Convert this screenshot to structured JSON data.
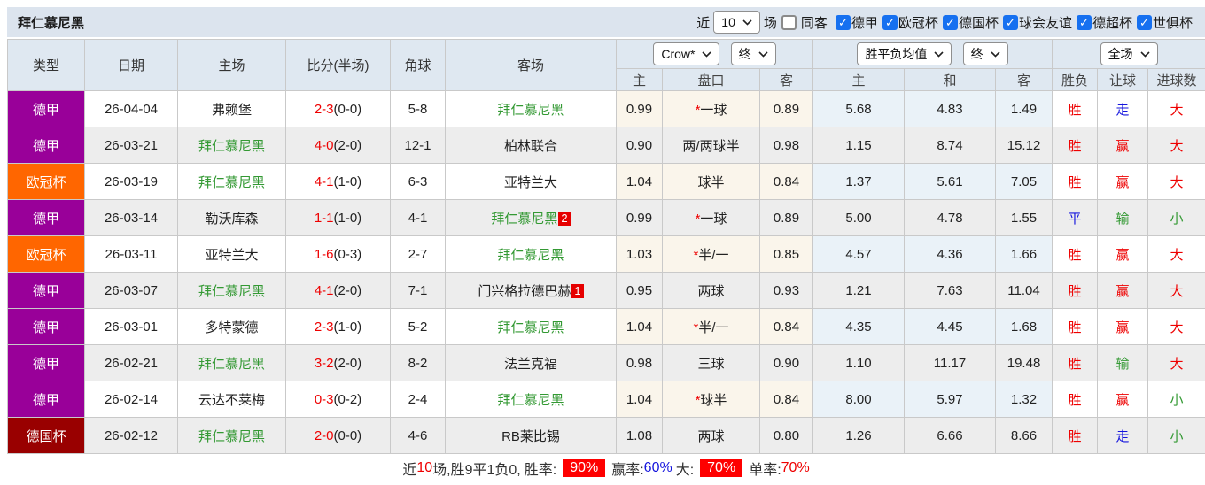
{
  "title": "拜仁慕尼黑",
  "controls": {
    "recent_label": "近",
    "recent_value": "10",
    "games_label": "场",
    "same_venue_label": "同客",
    "same_venue_checked": false,
    "competitions": [
      {
        "label": "德甲",
        "checked": true
      },
      {
        "label": "欧冠杯",
        "checked": true
      },
      {
        "label": "德国杯",
        "checked": true
      },
      {
        "label": "球会友谊",
        "checked": true
      },
      {
        "label": "德超杯",
        "checked": true
      },
      {
        "label": "世俱杯",
        "checked": true
      }
    ]
  },
  "table": {
    "columns_left": [
      "类型",
      "日期",
      "主场",
      "比分(半场)",
      "角球",
      "客场"
    ],
    "selects": {
      "odds_company": "Crow*",
      "odds_time": "终",
      "avg_name": "胜平负均值",
      "avg_time": "终",
      "scope": "全场"
    },
    "sub": [
      "主",
      "盘口",
      "客",
      "主",
      "和",
      "客",
      "胜负",
      "让球",
      "进球数"
    ]
  },
  "colors": {
    "league_dejia": "#990099",
    "league_ouguan": "#ff6600",
    "league_deguobei": "#990000",
    "win_red": "#ee0000",
    "draw_blue": "#1515dd",
    "lose_green": "#339933",
    "accent_badge": "#fe0000"
  },
  "matches": [
    {
      "type": "德甲",
      "type_color": "#990099",
      "date": "26-04-04",
      "home": "弗赖堡",
      "home_green": false,
      "score": "2-3",
      "half": "(0-0)",
      "corner": "5-8",
      "away": "拜仁慕尼黑",
      "away_green": true,
      "away_badge": "",
      "odds_home": "0.99",
      "handicap": "一球",
      "handicap_star": true,
      "odds_away": "0.89",
      "avg_home": "5.68",
      "avg_draw": "4.83",
      "avg_away": "1.49",
      "result": "胜",
      "result_color": "#ee0000",
      "handicap_result": "走",
      "handicap_result_color": "#1515dd",
      "goals": "大",
      "goals_color": "#ee0000"
    },
    {
      "type": "德甲",
      "type_color": "#990099",
      "date": "26-03-21",
      "home": "拜仁慕尼黑",
      "home_green": true,
      "score": "4-0",
      "half": "(2-0)",
      "corner": "12-1",
      "away": "柏林联合",
      "away_green": false,
      "away_badge": "",
      "odds_home": "0.90",
      "handicap": "两/两球半",
      "handicap_star": false,
      "odds_away": "0.98",
      "avg_home": "1.15",
      "avg_draw": "8.74",
      "avg_away": "15.12",
      "result": "胜",
      "result_color": "#ee0000",
      "handicap_result": "赢",
      "handicap_result_color": "#ee0000",
      "goals": "大",
      "goals_color": "#ee0000"
    },
    {
      "type": "欧冠杯",
      "type_color": "#ff6600",
      "date": "26-03-19",
      "home": "拜仁慕尼黑",
      "home_green": true,
      "score": "4-1",
      "half": "(1-0)",
      "corner": "6-3",
      "away": "亚特兰大",
      "away_green": false,
      "away_badge": "",
      "odds_home": "1.04",
      "handicap": "球半",
      "handicap_star": false,
      "odds_away": "0.84",
      "avg_home": "1.37",
      "avg_draw": "5.61",
      "avg_away": "7.05",
      "result": "胜",
      "result_color": "#ee0000",
      "handicap_result": "赢",
      "handicap_result_color": "#ee0000",
      "goals": "大",
      "goals_color": "#ee0000"
    },
    {
      "type": "德甲",
      "type_color": "#990099",
      "date": "26-03-14",
      "home": "勒沃库森",
      "home_green": false,
      "score": "1-1",
      "half": "(1-0)",
      "corner": "4-1",
      "away": "拜仁慕尼黑",
      "away_green": true,
      "away_badge": "2",
      "odds_home": "0.99",
      "handicap": "一球",
      "handicap_star": true,
      "odds_away": "0.89",
      "avg_home": "5.00",
      "avg_draw": "4.78",
      "avg_away": "1.55",
      "result": "平",
      "result_color": "#1515dd",
      "handicap_result": "输",
      "handicap_result_color": "#339933",
      "goals": "小",
      "goals_color": "#339933"
    },
    {
      "type": "欧冠杯",
      "type_color": "#ff6600",
      "date": "26-03-11",
      "home": "亚特兰大",
      "home_green": false,
      "score": "1-6",
      "half": "(0-3)",
      "corner": "2-7",
      "away": "拜仁慕尼黑",
      "away_green": true,
      "away_badge": "",
      "odds_home": "1.03",
      "handicap": "半/一",
      "handicap_star": true,
      "odds_away": "0.85",
      "avg_home": "4.57",
      "avg_draw": "4.36",
      "avg_away": "1.66",
      "result": "胜",
      "result_color": "#ee0000",
      "handicap_result": "赢",
      "handicap_result_color": "#ee0000",
      "goals": "大",
      "goals_color": "#ee0000"
    },
    {
      "type": "德甲",
      "type_color": "#990099",
      "date": "26-03-07",
      "home": "拜仁慕尼黑",
      "home_green": true,
      "score": "4-1",
      "half": "(2-0)",
      "corner": "7-1",
      "away": "门兴格拉德巴赫",
      "away_green": false,
      "away_badge": "1",
      "odds_home": "0.95",
      "handicap": "两球",
      "handicap_star": false,
      "odds_away": "0.93",
      "avg_home": "1.21",
      "avg_draw": "7.63",
      "avg_away": "11.04",
      "result": "胜",
      "result_color": "#ee0000",
      "handicap_result": "赢",
      "handicap_result_color": "#ee0000",
      "goals": "大",
      "goals_color": "#ee0000"
    },
    {
      "type": "德甲",
      "type_color": "#990099",
      "date": "26-03-01",
      "home": "多特蒙德",
      "home_green": false,
      "score": "2-3",
      "half": "(1-0)",
      "corner": "5-2",
      "away": "拜仁慕尼黑",
      "away_green": true,
      "away_badge": "",
      "odds_home": "1.04",
      "handicap": "半/一",
      "handicap_star": true,
      "odds_away": "0.84",
      "avg_home": "4.35",
      "avg_draw": "4.45",
      "avg_away": "1.68",
      "result": "胜",
      "result_color": "#ee0000",
      "handicap_result": "赢",
      "handicap_result_color": "#ee0000",
      "goals": "大",
      "goals_color": "#ee0000"
    },
    {
      "type": "德甲",
      "type_color": "#990099",
      "date": "26-02-21",
      "home": "拜仁慕尼黑",
      "home_green": true,
      "score": "3-2",
      "half": "(2-0)",
      "corner": "8-2",
      "away": "法兰克福",
      "away_green": false,
      "away_badge": "",
      "odds_home": "0.98",
      "handicap": "三球",
      "handicap_star": false,
      "odds_away": "0.90",
      "avg_home": "1.10",
      "avg_draw": "11.17",
      "avg_away": "19.48",
      "result": "胜",
      "result_color": "#ee0000",
      "handicap_result": "输",
      "handicap_result_color": "#339933",
      "goals": "大",
      "goals_color": "#ee0000"
    },
    {
      "type": "德甲",
      "type_color": "#990099",
      "date": "26-02-14",
      "home": "云达不莱梅",
      "home_green": false,
      "score": "0-3",
      "half": "(0-2)",
      "corner": "2-4",
      "away": "拜仁慕尼黑",
      "away_green": true,
      "away_badge": "",
      "odds_home": "1.04",
      "handicap": "球半",
      "handicap_star": true,
      "odds_away": "0.84",
      "avg_home": "8.00",
      "avg_draw": "5.97",
      "avg_away": "1.32",
      "result": "胜",
      "result_color": "#ee0000",
      "handicap_result": "赢",
      "handicap_result_color": "#ee0000",
      "goals": "小",
      "goals_color": "#339933"
    },
    {
      "type": "德国杯",
      "type_color": "#990000",
      "date": "26-02-12",
      "home": "拜仁慕尼黑",
      "home_green": true,
      "score": "2-0",
      "half": "(0-0)",
      "corner": "4-6",
      "away": "RB莱比锡",
      "away_green": false,
      "away_badge": "",
      "odds_home": "1.08",
      "handicap": "两球",
      "handicap_star": false,
      "odds_away": "0.80",
      "avg_home": "1.26",
      "avg_draw": "6.66",
      "avg_away": "8.66",
      "result": "胜",
      "result_color": "#ee0000",
      "handicap_result": "走",
      "handicap_result_color": "#1515dd",
      "goals": "小",
      "goals_color": "#339933"
    }
  ],
  "footer": {
    "recent_label": "近",
    "recent_count": "10",
    "record": "场,胜9平1负0,",
    "win_rate_label": "胜率:",
    "win_rate": "90%",
    "odds_rate_label": "赢率:",
    "odds_rate": "60%",
    "big_label": "大:",
    "big_rate": "70%",
    "single_label": "单率:",
    "single_rate": "70%"
  }
}
